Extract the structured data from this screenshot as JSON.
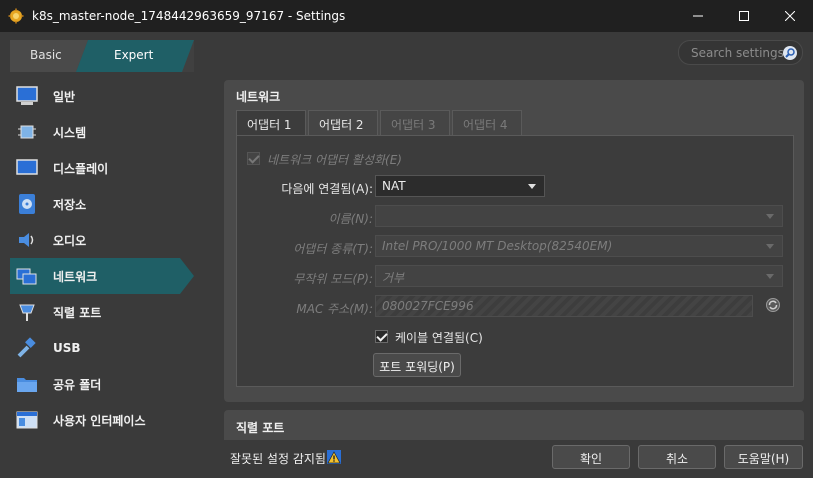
{
  "window": {
    "title": "k8s_master-node_1748442963659_97167 - Settings",
    "controls": {
      "minimize": "—",
      "maximize": "☐",
      "close": "✕"
    }
  },
  "mode": {
    "basic": "Basic",
    "expert": "Expert",
    "active": "Expert"
  },
  "search": {
    "placeholder": "Search settings"
  },
  "sidebar": {
    "items": [
      {
        "label": "일반",
        "icon": "general-icon"
      },
      {
        "label": "시스템",
        "icon": "system-icon"
      },
      {
        "label": "디스플레이",
        "icon": "display-icon"
      },
      {
        "label": "저장소",
        "icon": "storage-icon"
      },
      {
        "label": "오디오",
        "icon": "audio-icon"
      },
      {
        "label": "네트워크",
        "icon": "network-icon",
        "active": true
      },
      {
        "label": "직렬 포트",
        "icon": "serial-port-icon"
      },
      {
        "label": "USB",
        "icon": "usb-icon"
      },
      {
        "label": "공유 폴더",
        "icon": "shared-folder-icon"
      },
      {
        "label": "사용자 인터페이스",
        "icon": "user-interface-icon"
      }
    ]
  },
  "network": {
    "title": "네트워크",
    "tabs": [
      {
        "label": "어댑터 1",
        "active": true
      },
      {
        "label": "어댑터 2"
      },
      {
        "label": "어댑터 3",
        "disabled": true
      },
      {
        "label": "어댑터 4",
        "disabled": true
      }
    ],
    "enable_adapter": "네트워크 어댑터 활성화(E)",
    "attached_to_label": "다음에 연결됨(A):",
    "attached_to_value": "NAT",
    "name_label": "이름(N):",
    "name_value": "",
    "adapter_type_label": "어댑터 종류(T):",
    "adapter_type_value": "Intel PRO/1000 MT Desktop(82540EM)",
    "promiscuous_label": "무작위 모드(P):",
    "promiscuous_value": "거부",
    "mac_label": "MAC 주소(M):",
    "mac_value": "080027FCE996",
    "cable_connected": "케이블 연결됨(C)",
    "port_forwarding": "포트 포워딩(P)"
  },
  "serial": {
    "title": "직렬 포트"
  },
  "footer": {
    "warning": "잘못된 설정 감지됨",
    "ok": "확인",
    "cancel": "취소",
    "help": "도움말(H)"
  },
  "colors": {
    "accent": "#1f5f66",
    "background": "#3a3a3a",
    "titlebar": "#202020"
  }
}
